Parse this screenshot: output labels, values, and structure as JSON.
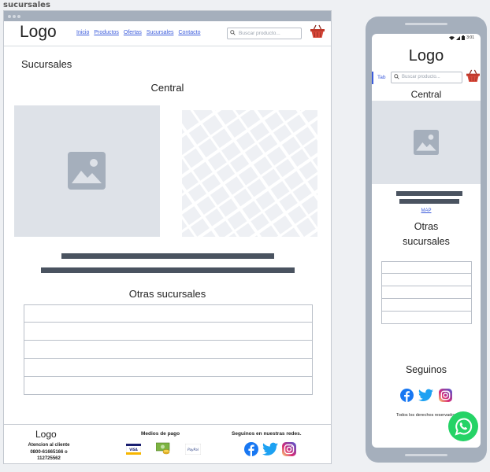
{
  "page_label": "sucursales",
  "desktop": {
    "logo": "Logo",
    "nav": [
      "Inicio",
      "Productos",
      "Ofertas",
      "Sucursales",
      "Contacto"
    ],
    "search_placeholder": "Buscar producto...",
    "section_title": "Sucursales",
    "branch_name": "Central",
    "other_branches_title": "Otras sucursales",
    "other_branches_rows": 5,
    "footer": {
      "logo": "Logo",
      "contact_lines": [
        "Atencion al cliente",
        "0800-61665166 o",
        "112725562"
      ],
      "payments_title": "Medios de pago",
      "payments": [
        "VISA",
        "cash",
        "PayPal"
      ],
      "social_title": "Seguinos en nuestras redes."
    }
  },
  "mobile": {
    "status_time": "3:01",
    "logo": "Logo",
    "tab_label": "Tab",
    "search_placeholder": "Buscar producto...",
    "branch_name": "Central",
    "map_link": "MAP",
    "other_branches_title_line1": "Otras",
    "other_branches_title_line2": "sucursales",
    "other_branches_rows": 5,
    "follow_title": "Seguinos",
    "rights": "Todos los derechos reservados"
  },
  "icons": {
    "cart": "shopping-basket-icon",
    "search": "search-icon",
    "facebook": "facebook-icon",
    "twitter": "twitter-icon",
    "instagram": "instagram-icon",
    "whatsapp": "whatsapp-icon",
    "image_placeholder": "image-placeholder-icon"
  },
  "colors": {
    "accent_link": "#3b5bdb",
    "cart_red": "#c0392b",
    "facebook": "#1877f2",
    "twitter": "#1da1f2",
    "whatsapp": "#25d366",
    "frame": "#a5afbc",
    "placeholder": "#dee2e8"
  }
}
